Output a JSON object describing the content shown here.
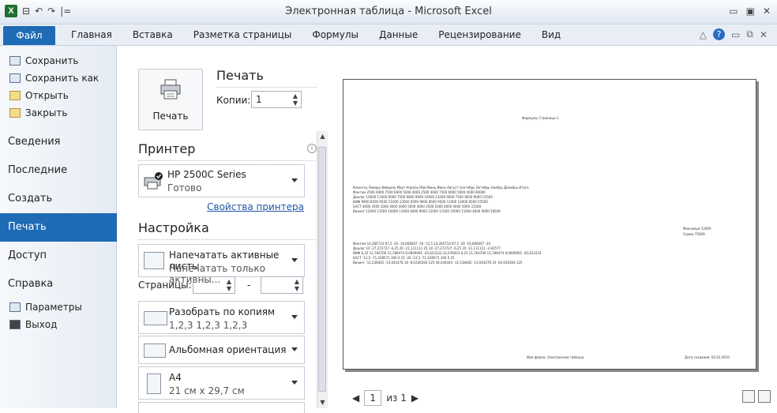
{
  "window": {
    "title": "Электронная таблица - Microsoft Excel",
    "qat": [
      "⊟",
      "↶",
      "↷",
      "|="
    ]
  },
  "ribbon": {
    "file_tab": "Файл",
    "tabs": [
      "Главная",
      "Вставка",
      "Разметка страницы",
      "Формулы",
      "Данные",
      "Рецензирование",
      "Вид"
    ]
  },
  "left_menu": {
    "commands": [
      "Сохранить",
      "Сохранить как",
      "Открыть",
      "Закрыть"
    ],
    "categories": [
      "Сведения",
      "Последние",
      "Создать",
      "Печать",
      "Доступ",
      "Справка"
    ],
    "bottom": [
      "Параметры",
      "Выход"
    ],
    "selected": "Печать"
  },
  "print": {
    "button_label": "Печать",
    "heading": "Печать",
    "copies_label": "Копии:",
    "copies_value": "1"
  },
  "printer": {
    "heading": "Принтер",
    "name": "HP 2500C Series",
    "status": "Готово",
    "properties_link": "Свойства принтера"
  },
  "settings": {
    "heading": "Настройка",
    "what": {
      "title": "Напечатать активные листы",
      "sub": "Напечатать только активны..."
    },
    "pages_label": "Страницы:",
    "pages_dash": "-",
    "collate": {
      "title": "Разобрать по копиям",
      "sub": "1,2,3   1,2,3   1,2,3"
    },
    "orientation": {
      "title": "Альбомная ориентация"
    },
    "paper": {
      "title": "А4",
      "sub": "21 см x 29,7 см"
    }
  },
  "preview": {
    "page_current": "1",
    "page_total": "из 1",
    "header": "Формулы; Страница 1",
    "footer_left": "Имя файла: Электронная таблица",
    "footer_right": "Дата создания: 03.03.2010",
    "table_rows": [
      "Клиенты   Январь   Февраль   Март   Апрель   Май   Июнь   Июль   Август   Сентябрь   Октябрь   Ноябрь   Декабрь        Итого",
      "Фантом      2500     4000    7500    6000    5000    4000    2500     4000    7500    6000    5000    4000           60000",
      "Диалог     10000    11000    9000    7500    9000    9000   10000    11000    9000    7500    9000    9000           53500",
      "ВИФ         9000     8500    9500   11000   12000    6500    9000     8500    9500   11000   12000    6500           55500",
      "БАСТ        4000     3500    1000    4000    4000    5000    4000     3500    1000    4000    4000    5000           31500",
      "Визинт     12000    11500   10000   11000    4000    9000   12000    11500   10000   11000    4000    9000           58500"
    ],
    "summary": [
      "Максимум   12000",
      "Сумма        75000"
    ],
    "table2_rows": [
      "Фантом   14,285714    87,5    -20  -16,666667    -20    -12,5  14,285714    87,5    -20  -16,666667    -20",
      "Диалог        10   -27,272727   -6,25     20  -21,111111    25     10  -27,272727   -6,25     20  -11,111111       -2,92577",
      "ВИФ        6,25  11,764706  15,789474  9,0909091  -45,833333  33,076923   6,25  11,764706  15,789474  9,0909091  -45,833333",
      "БАСТ      -12,5  -71,428571    300      0     25    -20    -12,5  -71,428571    300      0     25",
      "Визинт  -11,538462  -13,043478    10  -63,636364    125  44,444444  -11,538462  -13,043478    10  -63,636364    125"
    ]
  }
}
